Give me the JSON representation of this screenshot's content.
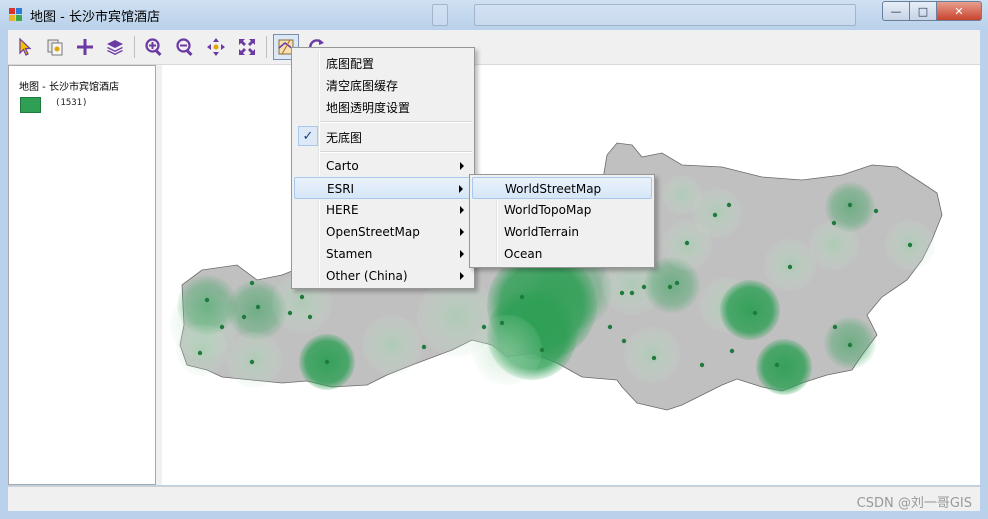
{
  "window": {
    "title": "地图 - 长沙市宾馆酒店",
    "controls": {
      "minimize": "—",
      "maximize": "□",
      "close": "✕"
    }
  },
  "toolbar": {
    "tools": [
      {
        "name": "select-icon"
      },
      {
        "name": "identify-icon"
      },
      {
        "name": "add-icon"
      },
      {
        "name": "layers-icon"
      },
      {
        "name": "zoom-in-icon"
      },
      {
        "name": "zoom-out-icon"
      },
      {
        "name": "pan-icon"
      },
      {
        "name": "full-extent-icon"
      },
      {
        "name": "basemap-icon"
      },
      {
        "name": "refresh-icon"
      }
    ]
  },
  "legend": {
    "layer_title": "地图 - 长沙市宾馆酒店",
    "count": "(1531)",
    "swatch_color": "#2e9f55"
  },
  "context_menu": {
    "items": [
      {
        "label": "底图配置"
      },
      {
        "label": "清空底图缓存"
      },
      {
        "label": "地图透明度设置"
      },
      {
        "label": "无底图",
        "checked": true
      },
      {
        "label": "Carto",
        "submenu": true
      },
      {
        "label": "ESRI",
        "submenu": true,
        "highlighted": true
      },
      {
        "label": "HERE",
        "submenu": true
      },
      {
        "label": "OpenStreetMap",
        "submenu": true
      },
      {
        "label": "Stamen",
        "submenu": true
      },
      {
        "label": "Other (China)",
        "submenu": true
      }
    ],
    "check_glyph": "✓"
  },
  "esri_submenu": {
    "items": [
      {
        "label": "WorldStreetMap",
        "highlighted": true
      },
      {
        "label": "WorldTopoMap"
      },
      {
        "label": "WorldTerrain"
      },
      {
        "label": "Ocean"
      }
    ]
  },
  "watermark": "CSDN @刘一哥GIS",
  "colors": {
    "region_fill": "#c0c0c0",
    "heat": "#2e9f55",
    "point": "#1f7a3c"
  }
}
